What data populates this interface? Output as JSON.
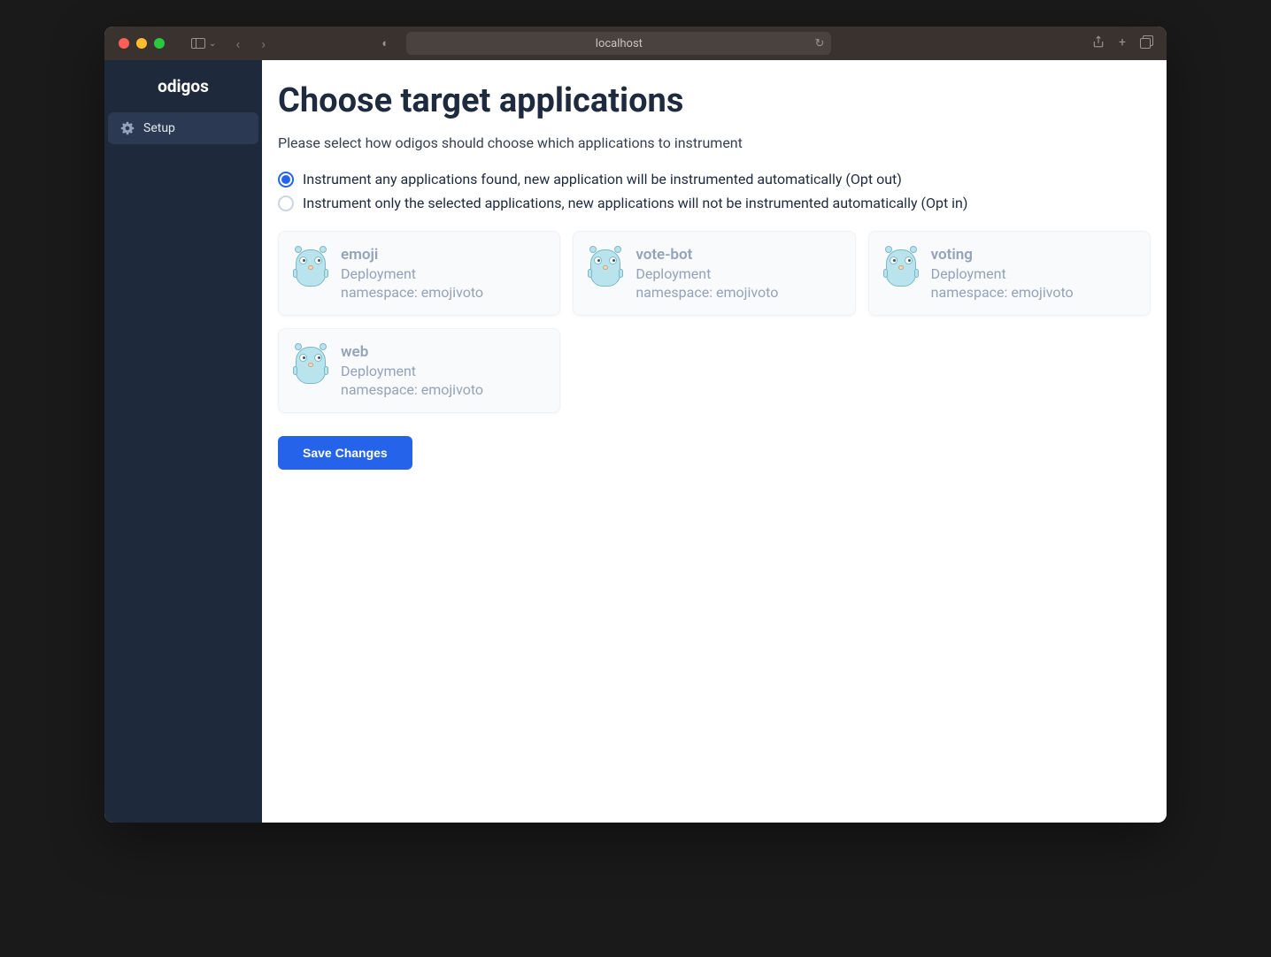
{
  "browser": {
    "address": "localhost"
  },
  "sidebar": {
    "brand": "odigos",
    "items": [
      {
        "label": "Setup"
      }
    ]
  },
  "page": {
    "title": "Choose target applications",
    "subtitle": "Please select how odigos should choose which applications to instrument"
  },
  "radios": [
    {
      "label": "Instrument any applications found, new application will be instrumented automatically (Opt out)",
      "checked": true
    },
    {
      "label": "Instrument only the selected applications, new applications will not be instrumented automatically (Opt in)",
      "checked": false
    }
  ],
  "apps": [
    {
      "name": "emoji",
      "kind": "Deployment",
      "namespace": "namespace: emojivoto"
    },
    {
      "name": "vote-bot",
      "kind": "Deployment",
      "namespace": "namespace: emojivoto"
    },
    {
      "name": "voting",
      "kind": "Deployment",
      "namespace": "namespace: emojivoto"
    },
    {
      "name": "web",
      "kind": "Deployment",
      "namespace": "namespace: emojivoto"
    }
  ],
  "actions": {
    "save": "Save Changes"
  }
}
